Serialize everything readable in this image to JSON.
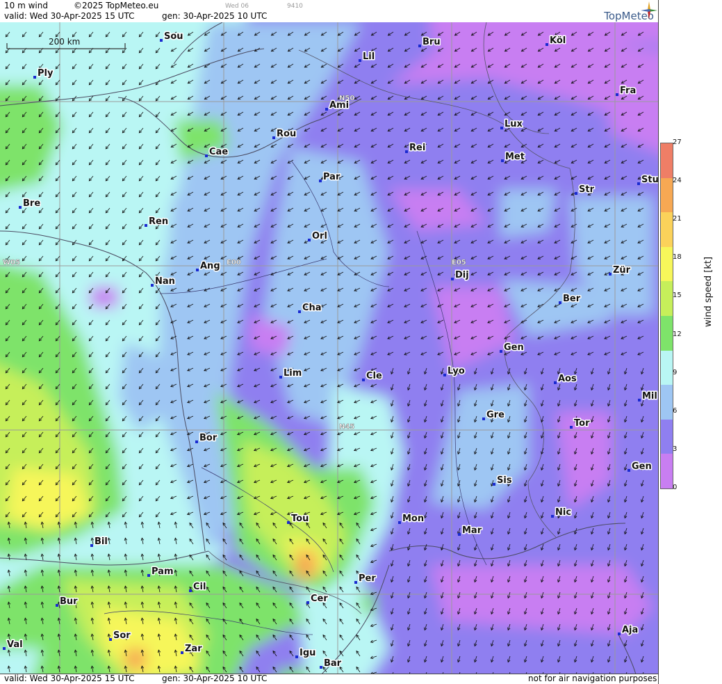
{
  "header": {
    "product": "10 m wind",
    "copyright": "©2025 TopMeteo.eu",
    "tab_day": "Wed 06",
    "tab_code": "9410",
    "valid": "valid:  Wed  30-Apr-2025  15 UTC",
    "gen": "gen:  30-Apr-2025 10 UTC",
    "brand": "TopMeteo"
  },
  "map": {
    "scale_label": "200 km",
    "grid_labels": [
      "N50",
      "E00",
      "E05",
      "W05",
      "N45"
    ],
    "cities": [
      {
        "name": "Sou"
      },
      {
        "name": "Ply"
      },
      {
        "name": "Lil"
      },
      {
        "name": "Bru"
      },
      {
        "name": "Köl"
      },
      {
        "name": "Ami"
      },
      {
        "name": "Fra"
      },
      {
        "name": "Rou"
      },
      {
        "name": "Lux"
      },
      {
        "name": "Cae"
      },
      {
        "name": "Rei"
      },
      {
        "name": "Met"
      },
      {
        "name": "Par"
      },
      {
        "name": "Stu"
      },
      {
        "name": "Bre"
      },
      {
        "name": "Str"
      },
      {
        "name": "Ren"
      },
      {
        "name": "Orl"
      },
      {
        "name": "Ang"
      },
      {
        "name": "Dij"
      },
      {
        "name": "Zür"
      },
      {
        "name": "Nan"
      },
      {
        "name": "Ber"
      },
      {
        "name": "Cha"
      },
      {
        "name": "Gen"
      },
      {
        "name": "Lim"
      },
      {
        "name": "Cle"
      },
      {
        "name": "Lyo"
      },
      {
        "name": "Aos"
      },
      {
        "name": "Mil"
      },
      {
        "name": "Gre"
      },
      {
        "name": "Tor"
      },
      {
        "name": "Bor"
      },
      {
        "name": "Gen"
      },
      {
        "name": "Sis"
      },
      {
        "name": "Nic"
      },
      {
        "name": "Tou"
      },
      {
        "name": "Mon"
      },
      {
        "name": "Mar"
      },
      {
        "name": "Bil"
      },
      {
        "name": "Pam"
      },
      {
        "name": "Per"
      },
      {
        "name": "Cil"
      },
      {
        "name": "Bur"
      },
      {
        "name": "Cer"
      },
      {
        "name": "Sor"
      },
      {
        "name": "Ajа"
      },
      {
        "name": "Zar"
      },
      {
        "name": "Val"
      },
      {
        "name": "Igu"
      },
      {
        "name": "Bar"
      }
    ]
  },
  "legend": {
    "title": "wind speed [kt]",
    "ticks": [
      "27",
      "24",
      "21",
      "18",
      "15",
      "12",
      "9",
      "6",
      "3",
      "0"
    ],
    "colors": [
      "#ef7e66",
      "#f6a853",
      "#fbd25a",
      "#f6f65a",
      "#c6ef5a",
      "#7ee36a",
      "#b9f6f4",
      "#9ec6f3",
      "#8f7ff0",
      "#c87ef2"
    ]
  },
  "footer": {
    "valid": "valid:  Wed  30-Apr-2025  15 UTC",
    "gen": "gen:  30-Apr-2025 10 UTC",
    "notice": "not for air navigation purposes"
  }
}
